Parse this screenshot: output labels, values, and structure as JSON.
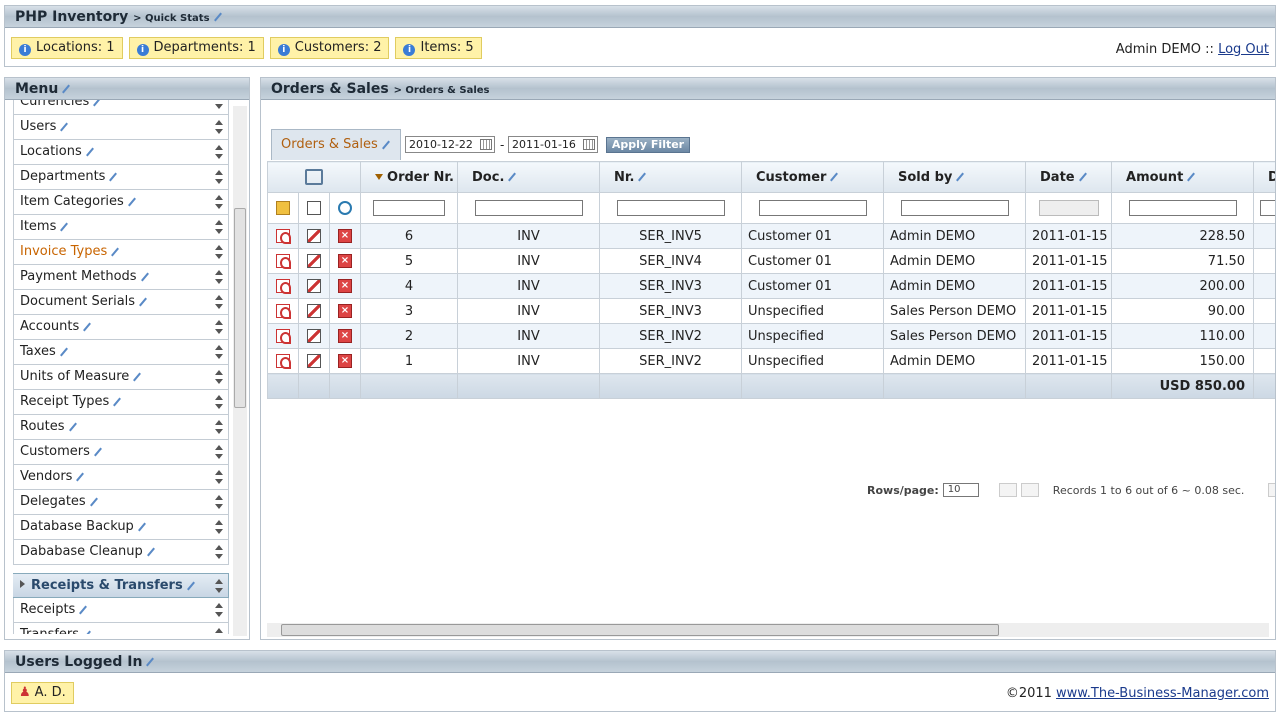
{
  "app": {
    "title": "PHP Inventory",
    "subtitle": "> Quick Stats"
  },
  "stats": [
    {
      "label": "Locations: 1"
    },
    {
      "label": "Departments: 1"
    },
    {
      "label": "Customers: 2"
    },
    {
      "label": "Items: 5"
    }
  ],
  "user": {
    "name": "Admin DEMO",
    "sep": "::",
    "logout": "Log Out"
  },
  "menu": {
    "title": "Menu",
    "items": [
      "Currencies",
      "Users",
      "Locations",
      "Departments",
      "Item Categories",
      "Items",
      "Invoice Types",
      "Payment Methods",
      "Document Serials",
      "Accounts",
      "Taxes",
      "Units of Measure",
      "Receipt Types",
      "Routes",
      "Customers",
      "Vendors",
      "Delegates",
      "Database Backup",
      "Dababase Cleanup"
    ],
    "selected": "Invoice Types",
    "group": "Receipts & Transfers",
    "group_items": [
      "Receipts",
      "Transfers"
    ]
  },
  "orders": {
    "title": "Orders & Sales",
    "crumb": "> Orders & Sales",
    "tab": "Orders & Sales",
    "date_from": "2010-12-22",
    "date_sep": "-",
    "date_to": "2011-01-16",
    "apply": "Apply Filter",
    "columns": [
      "Order Nr.",
      "Doc.",
      "Nr.",
      "Customer",
      "Sold by",
      "Date",
      "Amount",
      "De"
    ],
    "rows": [
      {
        "order": "6",
        "doc": "INV",
        "nr": "SER_INV5",
        "customer": "Customer 01",
        "soldby": "Admin DEMO",
        "date": "2011-01-15",
        "amount": "228.50"
      },
      {
        "order": "5",
        "doc": "INV",
        "nr": "SER_INV4",
        "customer": "Customer 01",
        "soldby": "Admin DEMO",
        "date": "2011-01-15",
        "amount": "71.50"
      },
      {
        "order": "4",
        "doc": "INV",
        "nr": "SER_INV3",
        "customer": "Customer 01",
        "soldby": "Admin DEMO",
        "date": "2011-01-15",
        "amount": "200.00"
      },
      {
        "order": "3",
        "doc": "INV",
        "nr": "SER_INV3",
        "customer": "Unspecified",
        "soldby": "Sales Person DEMO",
        "date": "2011-01-15",
        "amount": "90.00"
      },
      {
        "order": "2",
        "doc": "INV",
        "nr": "SER_INV2",
        "customer": "Unspecified",
        "soldby": "Sales Person DEMO",
        "date": "2011-01-15",
        "amount": "110.00"
      },
      {
        "order": "1",
        "doc": "INV",
        "nr": "SER_INV2",
        "customer": "Unspecified",
        "soldby": "Admin DEMO",
        "date": "2011-01-15",
        "amount": "150.00"
      }
    ],
    "total": "USD 850.00",
    "pager": {
      "rows_label": "Rows/page:",
      "rows_value": "10",
      "records": "Records 1 to 6 out of 6 ~ 0.08 sec."
    }
  },
  "users_logged": {
    "title": "Users Logged In",
    "user": "A. D.",
    "copyright": "©2011",
    "link": "www.The-Business-Manager.com"
  }
}
